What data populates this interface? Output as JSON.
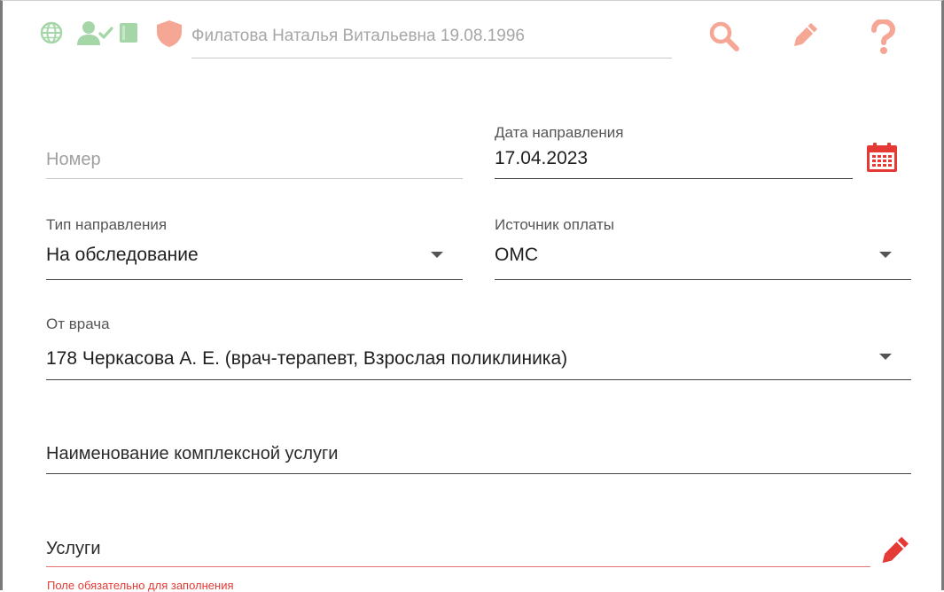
{
  "header": {
    "patient": "Филатова Наталья Витальевна 19.08.1996",
    "icons": [
      "globe-icon",
      "user-check-icon",
      "card-icon",
      "shield-icon",
      "search-icon",
      "pencil-icon",
      "help-icon"
    ],
    "colors": {
      "green": "#a5d6a7",
      "salmon": "#f6a694"
    }
  },
  "form": {
    "number": {
      "placeholder": "Номер"
    },
    "referral_date": {
      "label": "Дата направления",
      "value": "17.04.2023"
    },
    "referral_type": {
      "label": "Тип направления",
      "value": "На обследование"
    },
    "payment_source": {
      "label": "Источник оплаты",
      "value": "ОМС"
    },
    "from_doctor": {
      "label": "От врача",
      "value": "178 Черкасова А. Е. (врач-терапевт, Взрослая поликлиника)"
    },
    "complex_service": {
      "placeholder": "Наименование комплексной услуги"
    },
    "services": {
      "placeholder": "Услуги",
      "error": "Поле обязательно для заполнения"
    }
  },
  "colors": {
    "accent_red": "#e53935",
    "error_line": "#e57373"
  }
}
